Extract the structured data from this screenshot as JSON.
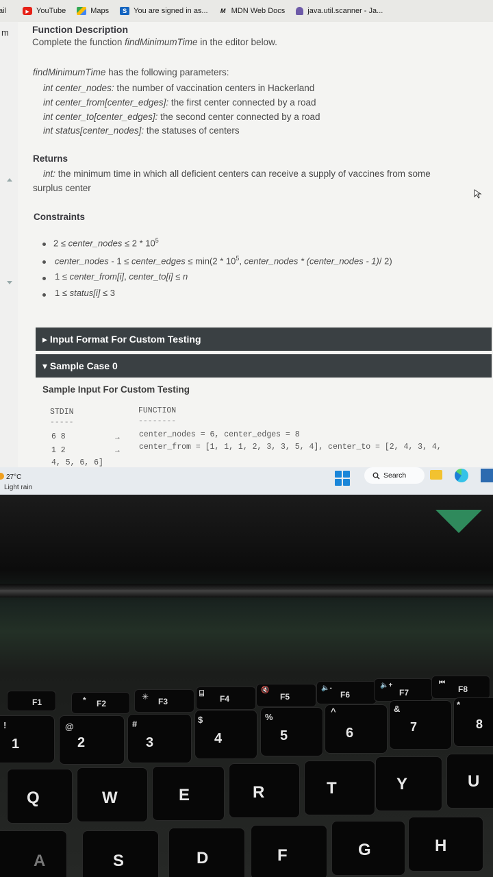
{
  "bookmarks": [
    {
      "label": "ail",
      "icon": "mail-icon"
    },
    {
      "label": "YouTube",
      "icon": "youtube-icon"
    },
    {
      "label": "Maps",
      "icon": "maps-icon"
    },
    {
      "label": "You are signed in as...",
      "icon": "s-icon"
    },
    {
      "label": "MDN Web Docs",
      "icon": "mdn-icon"
    },
    {
      "label": "java.util.scanner - Ja...",
      "icon": "java-icon"
    }
  ],
  "rail": {
    "glyph": "m"
  },
  "function_description": {
    "heading": "Function Description",
    "intro_pre": "Complete the function ",
    "intro_fn": "findMinimumTime",
    "intro_post": " in the editor below."
  },
  "parameters": {
    "fn": "findMinimumTime",
    "intro_post": " has the following parameters:",
    "items": [
      {
        "sig": "int center_nodes:",
        "desc": " the number of vaccination centers in Hackerland"
      },
      {
        "sig": "int center_from[center_edges]:",
        "desc": " the first center connected by a road"
      },
      {
        "sig": "int center_to[center_edges]:",
        "desc": " the second center connected by a road"
      },
      {
        "sig": "int status[center_nodes]:",
        "desc": "  the statuses of centers"
      }
    ]
  },
  "returns": {
    "heading": "Returns",
    "sig": "int:",
    "line1": " the minimum time in which all deficient centers can receive a supply of vaccines from some",
    "line2": "surplus center"
  },
  "constraints": {
    "heading": "Constraints",
    "c1_a": "2 ≤ ",
    "c1_b": "center_nodes",
    "c1_c": " ≤ 2 * 10",
    "c1_sup": "5",
    "c2_a": "center_nodes",
    "c2_b": " - 1 ≤ ",
    "c2_c": "center_edges",
    "c2_d": " ≤ min(2 * 10",
    "c2_sup": "5",
    "c2_e": ", ",
    "c2_f": "center_nodes * (center_nodes - 1)",
    "c2_g": "/ 2)",
    "c3_a": "1 ≤ ",
    "c3_b": "center_from[i]",
    "c3_c": ", ",
    "c3_d": "center_to[i]",
    "c3_e": " ≤ ",
    "c3_f": "n",
    "c4_a": "1 ≤ ",
    "c4_b": "status[i]",
    "c4_c": " ≤ 3"
  },
  "sections": {
    "input_format": "▸ Input Format For Custom Testing",
    "sample_case": "▾ Sample Case 0"
  },
  "sample": {
    "heading": "Sample Input For Custom Testing",
    "stdin_label": "STDIN",
    "stdin_rule": "-----",
    "function_label": "FUNCTION",
    "function_rule": "--------",
    "rows": [
      {
        "stdin": "6 8",
        "arrow": "→",
        "function": "center_nodes = 6, center_edges = 8"
      },
      {
        "stdin": "1 2",
        "arrow": "→",
        "function": "center_from = [1, 1, 1, 2, 3, 3, 5, 4], center_to = [2, 4, 3, 4,"
      },
      {
        "stdin": "4, 5, 6, 6]",
        "arrow": "",
        "function": ""
      }
    ]
  },
  "taskbar": {
    "temperature": "27°C",
    "weather": "Light rain",
    "search_label": "Search"
  },
  "keyboard": {
    "fkeys": [
      "F1",
      "F2",
      "F3",
      "F4",
      "F5",
      "F6",
      "F7",
      "F8"
    ],
    "fkey_symbols": [
      "",
      "*",
      "✳",
      "⌸",
      "🔇",
      "🔈-",
      "🔈+",
      "⏮"
    ],
    "number_row": [
      {
        "main": "1",
        "sub": "!"
      },
      {
        "main": "2",
        "sub": "@"
      },
      {
        "main": "3",
        "sub": "#"
      },
      {
        "main": "4",
        "sub": "$"
      },
      {
        "main": "5",
        "sub": "%"
      },
      {
        "main": "6",
        "sub": "^"
      },
      {
        "main": "7",
        "sub": "&"
      },
      {
        "main": "8",
        "sub": "*"
      }
    ],
    "qwerty_row": [
      "Q",
      "W",
      "E",
      "R",
      "T",
      "Y",
      "U"
    ],
    "home_row": [
      "A",
      "S",
      "D",
      "F",
      "G",
      "H"
    ]
  }
}
